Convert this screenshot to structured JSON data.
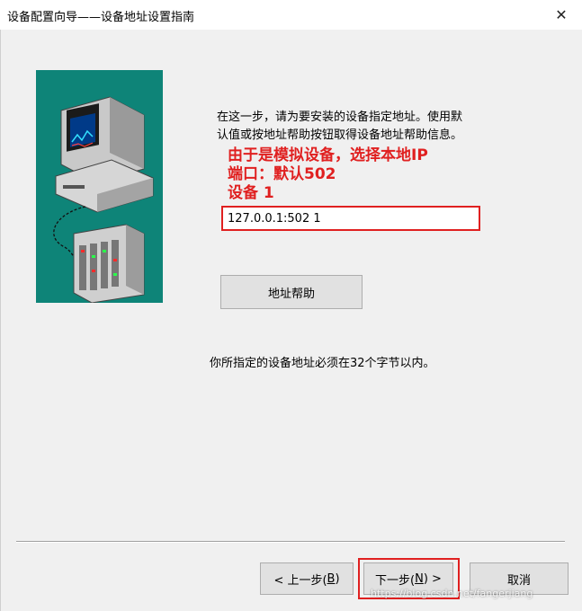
{
  "window": {
    "title": "设备配置向导——设备地址设置指南",
    "close_glyph": "✕"
  },
  "illustration": {
    "icon": "computer-and-plc-icon"
  },
  "description": {
    "line1": "在这一步，请为要安装的设备指定地址。使用默",
    "line2": "认值或按地址帮助按钮取得设备地址帮助信息。"
  },
  "annotation": {
    "line1": "由于是模拟设备，选择本地IP",
    "line2": "端口：默认502",
    "line3": "设备 1",
    "color": "#e02020"
  },
  "address": {
    "value": "127.0.0.1:502 1"
  },
  "buttons": {
    "address_help": "地址帮助",
    "back_prefix": "< 上一步(",
    "back_key": "B",
    "back_suffix": ")",
    "next_prefix": "下一步(",
    "next_key": "N",
    "next_suffix": ") >",
    "cancel": "取消"
  },
  "limit_note": "你所指定的设备地址必须在32个字节以内。",
  "watermark": "https://blog.csdn.net/fangerjiang"
}
